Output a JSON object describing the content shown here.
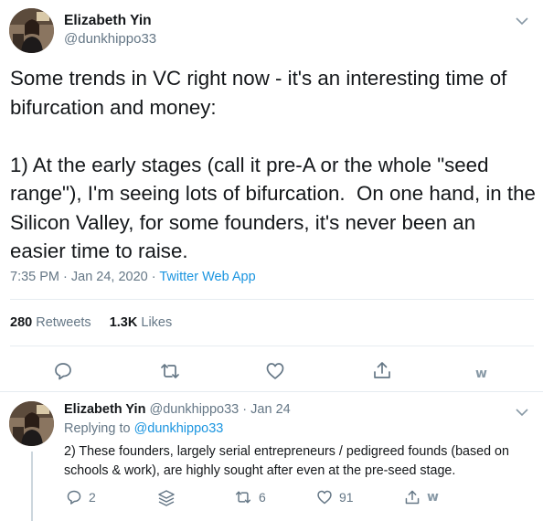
{
  "main_tweet": {
    "author_name": "Elizabeth Yin",
    "author_handle": "@dunkhippo33",
    "text": "Some trends in VC right now - it's an interesting time of bifurcation and money:\n\n1) At the early stages (call it pre-A or the whole \"seed range\"), I'm seeing lots of bifurcation.  On one hand, in the Silicon Valley, for some founders, it's never been an easier time to raise.",
    "timestamp": "7:35 PM · Jan 24, 2020 · ",
    "source": "Twitter Web App",
    "retweets_count": "280",
    "retweets_label": "Retweets",
    "likes_count": "1.3K",
    "likes_label": "Likes",
    "extension_mark": "w"
  },
  "reply_tweet": {
    "author_name": "Elizabeth Yin",
    "author_handle": "@dunkhippo33",
    "separator": "·",
    "date": "Jan 24",
    "replying_to_label": "Replying to",
    "replying_to_handle": "@dunkhippo33",
    "text": "2) These founders, largely serial entrepreneurs / pedigreed founds (based on schools & work), are highly sought after even at the pre-seed stage.",
    "reply_count": "2",
    "retweet_count": "6",
    "like_count": "91",
    "extension_mark": "w"
  },
  "colors": {
    "text": "#14171a",
    "secondary": "#657786",
    "link": "#1b95e0",
    "divider": "#e6ecf0"
  }
}
